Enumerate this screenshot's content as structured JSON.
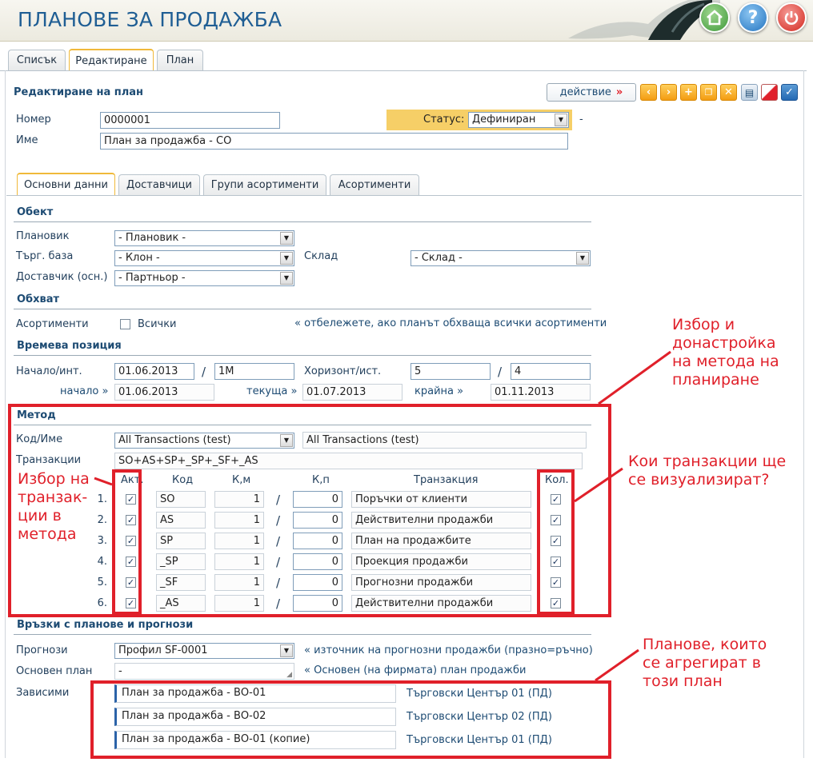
{
  "app": {
    "title": "ПЛАНОВЕ ЗА ПРОДАЖБА"
  },
  "header_icons": [
    "home-icon",
    "help-icon",
    "power-icon"
  ],
  "top_tabs": [
    {
      "label": "Списък"
    },
    {
      "label": "Редактиране"
    },
    {
      "label": "План"
    }
  ],
  "form": {
    "title": "Редактиране на план",
    "action_label": "действие",
    "action_arrow": "»",
    "number_label": "Номер",
    "number_value": "0000001",
    "name_label": "Име",
    "name_value": "План за продажба - СО",
    "status_label": "Статус:",
    "status_value": "Дефиниран",
    "status_dash": "-"
  },
  "sub_tabs": [
    {
      "label": "Основни данни"
    },
    {
      "label": "Доставчици"
    },
    {
      "label": "Групи асортименти"
    },
    {
      "label": "Асортименти"
    }
  ],
  "object": {
    "header": "Обект",
    "planner_label": "Плановик",
    "planner_value": "- Плановик -",
    "branch_label": "Търг. база",
    "branch_value": "- Клон -",
    "warehouse_label": "Склад",
    "warehouse_value": "- Склад -",
    "supplier_label": "Доставчик (осн.)",
    "supplier_value": "- Партньор -"
  },
  "scope": {
    "header": "Обхват",
    "assortments_label": "Асортименти",
    "all_label": "Всички",
    "all_checked": false,
    "hint": "« отбележете, ако планът обхваща всички асортименти"
  },
  "time": {
    "header": "Времева позиция",
    "start_int_label": "Начало/инт.",
    "start_value": "01.06.2013",
    "slash": "/",
    "interval_value": "1M",
    "horizon_label": "Хоризонт/ист.",
    "horizon_value": "5",
    "history_value": "4",
    "begin_label": "начало »",
    "begin_value": "01.06.2013",
    "current_label": "текуща »",
    "current_value": "01.07.2013",
    "end_label": "крайна »",
    "end_value": "01.11.2013"
  },
  "method": {
    "header": "Метод",
    "code_name_label": "Код/Име",
    "code_value": "All Transactions (test)",
    "name_value": "All Transactions (test)",
    "transactions_label": "Транзакции",
    "transactions_value": "SO+AS+SP+_SP+_SF+_AS",
    "columns": {
      "act": "Акт.",
      "code": "Код",
      "km": "К,м",
      "kp": "К,п",
      "trans": "Транзакция",
      "kol": "Кол."
    },
    "rows": [
      {
        "n": "1.",
        "act": true,
        "code": "SO",
        "km": "1",
        "sep": "/",
        "kp": "0",
        "trans": "Поръчки от клиенти",
        "kol": true
      },
      {
        "n": "2.",
        "act": true,
        "code": "AS",
        "km": "1",
        "sep": "/",
        "kp": "0",
        "trans": "Действителни продажби",
        "kol": true
      },
      {
        "n": "3.",
        "act": true,
        "code": "SP",
        "km": "1",
        "sep": "/",
        "kp": "0",
        "trans": "План на продажбите",
        "kol": true
      },
      {
        "n": "4.",
        "act": true,
        "code": "_SP",
        "km": "1",
        "sep": "/",
        "kp": "0",
        "trans": "Проекция продажби",
        "kol": true
      },
      {
        "n": "5.",
        "act": true,
        "code": "_SF",
        "km": "1",
        "sep": "/",
        "kp": "0",
        "trans": "Прогнозни продажби",
        "kol": true
      },
      {
        "n": "6.",
        "act": true,
        "code": "_AS",
        "km": "1",
        "sep": "/",
        "kp": "0",
        "trans": "Действителни продажби",
        "kol": true
      }
    ]
  },
  "links": {
    "header": "Връзки с планове и прогнози",
    "forecasts_label": "Прогнози",
    "forecasts_value": "Профил SF-0001",
    "forecasts_hint": "« източник на прогнозни продажби (празно=ръчно)",
    "base_label": "Основен план",
    "base_value": "-",
    "base_hint": "« Основен (на фирмата) план продажби",
    "dependents_label": "Зависими",
    "dependents": [
      {
        "plan": "План за продажба - ВО-01",
        "center": "Търговски Център 01 (ПД)"
      },
      {
        "plan": "План за продажба - ВО-02",
        "center": "Търговски Център 02 (ПД)"
      },
      {
        "plan": "План за продажба - ВО-01 (копие)",
        "center": "Търговски Център 01 (ПД)"
      }
    ]
  },
  "annotations": {
    "method_note": [
      "Избор и",
      "донастройка",
      "на метода на",
      "планиране"
    ],
    "select_note": [
      "Избор на",
      "транзак-",
      "ции в",
      "метода"
    ],
    "visualize_note": [
      "Кои транзакции ще",
      "се визуализират?"
    ],
    "aggregate_note": [
      "Планове, които",
      "се агрегират в",
      "този план"
    ]
  },
  "colors": {
    "accent": "#f0b93a",
    "title": "#1f5e94",
    "annotation": "#e0202a"
  }
}
